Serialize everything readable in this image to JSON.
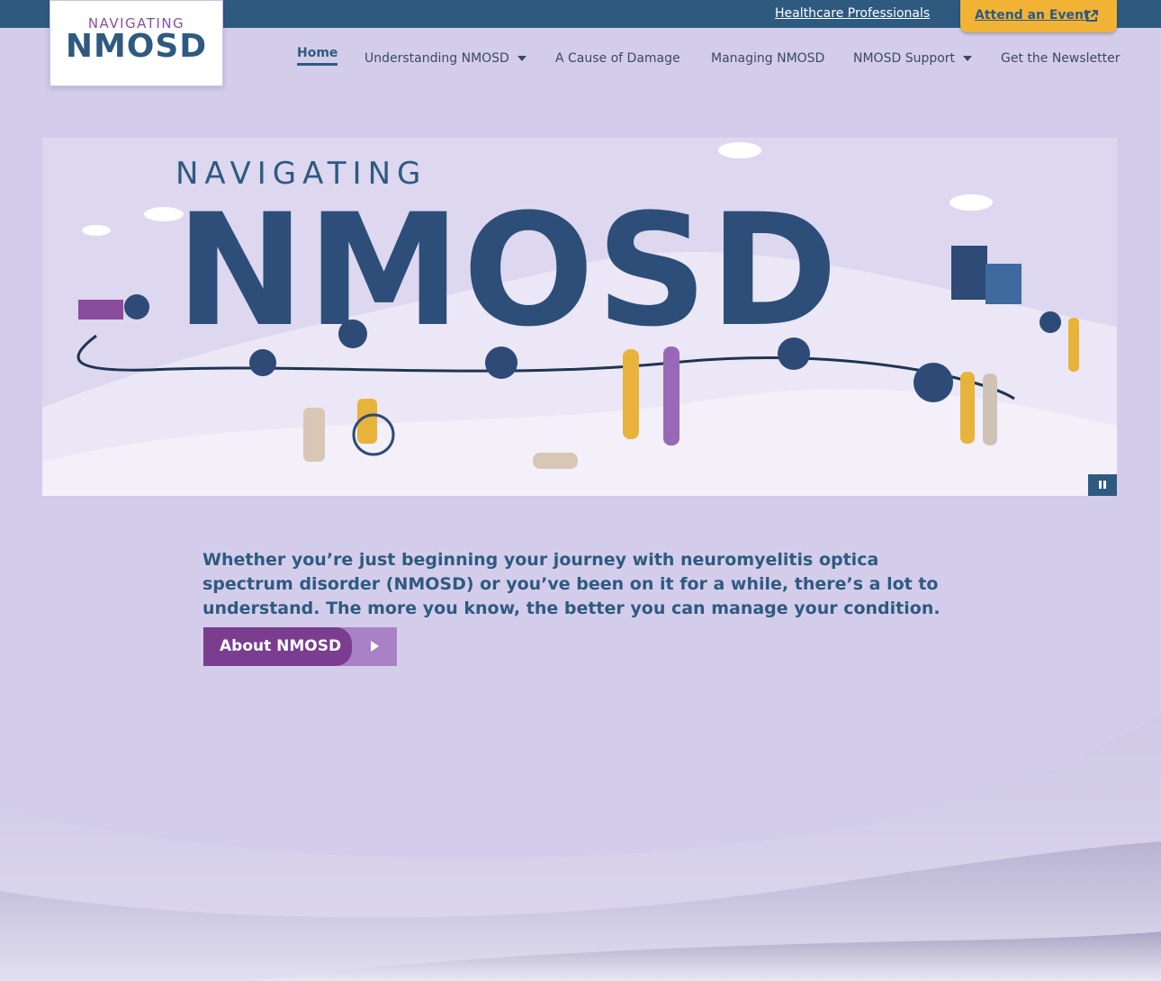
{
  "topbar": {
    "hcp_link": "Healthcare Professionals",
    "event_button": "Attend an Event"
  },
  "logo": {
    "small_text": "NAVIGATING",
    "big_text": "NMOSD"
  },
  "nav": {
    "items": [
      {
        "label": "Home",
        "active": true
      },
      {
        "label": "Understanding NMOSD",
        "has_dropdown": true
      },
      {
        "label": "A Cause of Damage"
      },
      {
        "label": "Managing NMOSD"
      },
      {
        "label": "NMOSD Support",
        "has_dropdown": true
      },
      {
        "label": "Get the Newsletter"
      }
    ]
  },
  "hero": {
    "small_title": "NAVIGATING",
    "big_title": "NMOSD",
    "pause_icon": "pause-icon"
  },
  "intro": {
    "text": "Whether you’re just beginning your journey with neuromyelitis optica spectrum disorder (NMOSD) or you’ve been on it for a while, there’s a lot to understand. The more you know, the better you can manage your condition."
  },
  "cta": {
    "label": "About NMOSD",
    "icon": "play-icon"
  },
  "colors": {
    "brand_blue": "#2f5a80",
    "brand_purple": "#7a3d8f",
    "accent_yellow": "#f2b334",
    "background_lavender": "#d3cdeb"
  }
}
